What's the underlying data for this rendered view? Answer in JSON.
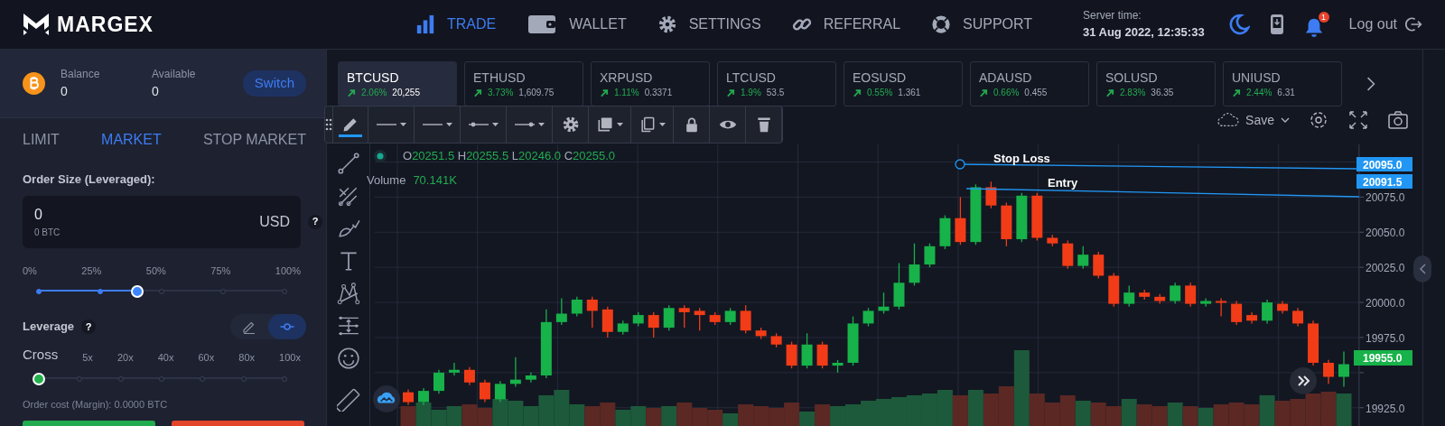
{
  "brand": {
    "name": "MARGEX"
  },
  "nav": [
    {
      "kind": "bars",
      "label": "TRADE",
      "selected": true
    },
    {
      "kind": "wallet",
      "label": "WALLET",
      "selected": false
    },
    {
      "kind": "gear",
      "label": "SETTINGS",
      "selected": false
    },
    {
      "kind": "link",
      "label": "REFERRAL",
      "selected": false
    },
    {
      "kind": "lifebuoy",
      "label": "SUPPORT",
      "selected": false
    }
  ],
  "server_time": {
    "label": "Server time:",
    "value": "31 Aug 2022, 12:35:33"
  },
  "notifications": {
    "count": "1"
  },
  "logout": "Log out",
  "balance": {
    "balance_label": "Balance",
    "balance": "0",
    "available_label": "Available",
    "available": "0",
    "switch": "Switch"
  },
  "order_tabs": [
    {
      "label": "LIMIT",
      "selected": false
    },
    {
      "label": "MARKET",
      "selected": true
    },
    {
      "label": "STOP MARKET",
      "selected": false
    }
  ],
  "order_size": {
    "label": "Order Size (Leveraged):",
    "value": "0",
    "sub": "0 BTC",
    "currency": "USD",
    "help": "?"
  },
  "size_slider": {
    "marks": [
      "0%",
      "25%",
      "50%",
      "75%",
      "100%"
    ],
    "level": 0.4
  },
  "leverage": {
    "label": "Leverage",
    "help": "?",
    "modes": [
      {
        "kind": "pencil",
        "selected": false
      },
      {
        "kind": "slider",
        "selected": true
      }
    ],
    "first_mark": "Cross",
    "marks": [
      "5x",
      "20x",
      "40x",
      "60x",
      "80x",
      "100x"
    ],
    "level": 0
  },
  "order_cost": "Order cost (Margin): 0.0000 BTC",
  "tickers": [
    {
      "symbol": "BTCUSD",
      "change": "2.06%",
      "price": "20,255",
      "selected": true
    },
    {
      "symbol": "ETHUSD",
      "change": "3.73%",
      "price": "1,609.75",
      "selected": false
    },
    {
      "symbol": "XRPUSD",
      "change": "1.11%",
      "price": "0.3371",
      "selected": false
    },
    {
      "symbol": "LTCUSD",
      "change": "1.9%",
      "price": "53.5",
      "selected": false
    },
    {
      "symbol": "EOSUSD",
      "change": "0.55%",
      "price": "1.361",
      "selected": false
    },
    {
      "symbol": "ADAUSD",
      "change": "0.66%",
      "price": "0.455",
      "selected": false
    },
    {
      "symbol": "SOLUSD",
      "change": "2.83%",
      "price": "36.35",
      "selected": false
    },
    {
      "symbol": "UNIUSD",
      "change": "2.44%",
      "price": "6.31",
      "selected": false
    }
  ],
  "drawing_tools": [
    {
      "kind": "pencil",
      "selected": true
    },
    {
      "kind": "line",
      "selected": false
    },
    {
      "kind": "line",
      "selected": false
    },
    {
      "kind": "line-dot-start",
      "selected": false
    },
    {
      "kind": "line-dot-end",
      "selected": false
    },
    {
      "kind": "gear",
      "selected": false
    },
    {
      "kind": "layers",
      "selected": false
    },
    {
      "kind": "copy",
      "selected": false
    },
    {
      "kind": "lock",
      "selected": false
    },
    {
      "kind": "eye",
      "selected": false
    },
    {
      "kind": "trash",
      "selected": false
    }
  ],
  "chart_toolbar": {
    "save": "Save"
  },
  "legend": {
    "items": [
      {
        "key": "O",
        "value": "20251.5"
      },
      {
        "key": "H",
        "value": "20255.5"
      },
      {
        "key": "L",
        "value": "20246.0"
      },
      {
        "key": "C",
        "value": "20255.0"
      }
    ],
    "volume_label": "Volume",
    "volume": "70.141K"
  },
  "chart": {
    "chart_data": {
      "type": "candlestick",
      "grid": true,
      "ohlc": [
        [
          19936,
          19938,
          19927,
          19929
        ],
        [
          19929,
          19939,
          19927,
          19937
        ],
        [
          19937,
          19952,
          19935,
          19950
        ],
        [
          19950,
          19957,
          19948,
          19952
        ],
        [
          19952,
          19954,
          19941,
          19943
        ],
        [
          19943,
          19945,
          19929,
          19931
        ],
        [
          19931,
          19944,
          19929,
          19942
        ],
        [
          19942,
          19961,
          19940,
          19945
        ],
        [
          19945,
          19950,
          19943,
          19948
        ],
        [
          19948,
          19995,
          19946,
          19986
        ],
        [
          19986,
          20003,
          19984,
          19992
        ],
        [
          19992,
          20004,
          19990,
          20002
        ],
        [
          20002,
          20004,
          19982,
          19994
        ],
        [
          19995,
          19997,
          19975,
          19979
        ],
        [
          19979,
          19987,
          19977,
          19985
        ],
        [
          19985,
          19993,
          19983,
          19991
        ],
        [
          19991,
          19993,
          19975,
          19982
        ],
        [
          19982,
          19998,
          19980,
          19996
        ],
        [
          19996,
          19998,
          19982,
          19993
        ],
        [
          19994,
          19996,
          19980,
          19991
        ],
        [
          19991,
          19993,
          19984,
          19986
        ],
        [
          19986,
          19996,
          19984,
          19994
        ],
        [
          19994,
          19998,
          19978,
          19980
        ],
        [
          19980,
          19982,
          19974,
          19976
        ],
        [
          19976,
          19978,
          19968,
          19970
        ],
        [
          19970,
          19972,
          19953,
          19955
        ],
        [
          19955,
          19978,
          19953,
          19970
        ],
        [
          19970,
          19972,
          19953,
          19955
        ],
        [
          19955,
          19959,
          19950,
          19957
        ],
        [
          19957,
          19990,
          19955,
          19985
        ],
        [
          19985,
          19996,
          19983,
          19994
        ],
        [
          19994,
          20007,
          19992,
          19997
        ],
        [
          19997,
          20028,
          19995,
          20014
        ],
        [
          20014,
          20042,
          20012,
          20027
        ],
        [
          20027,
          20042,
          20025,
          20040
        ],
        [
          20040,
          20062,
          20038,
          20060
        ],
        [
          20060,
          20075,
          20041,
          20043
        ],
        [
          20043,
          20084,
          20041,
          20082
        ],
        [
          20082,
          20086,
          20067,
          20069
        ],
        [
          20069,
          20071,
          20040,
          20045
        ],
        [
          20045,
          20078,
          20043,
          20076
        ],
        [
          20076,
          20078,
          20044,
          20046
        ],
        [
          20046,
          20048,
          20040,
          20042
        ],
        [
          20042,
          20044,
          20024,
          20026
        ],
        [
          20026,
          20040,
          20024,
          20034
        ],
        [
          20034,
          20036,
          20017,
          20019
        ],
        [
          20019,
          20021,
          19997,
          19999
        ],
        [
          19999,
          20012,
          19997,
          20007
        ],
        [
          20007,
          20009,
          20002,
          20004
        ],
        [
          20004,
          20006,
          19999,
          20001
        ],
        [
          20001,
          20014,
          19999,
          20012
        ],
        [
          20012,
          20014,
          19997,
          19999
        ],
        [
          19999,
          20003,
          19997,
          20001
        ],
        [
          20001,
          20003,
          19990,
          20000
        ],
        [
          19999,
          20001,
          19984,
          19986
        ],
        [
          19991,
          19993,
          19985,
          19987
        ],
        [
          19987,
          20002,
          19985,
          20000
        ],
        [
          19999,
          20001,
          19992,
          19994
        ],
        [
          19994,
          19996,
          19983,
          19985
        ],
        [
          19985,
          19987,
          19955,
          19957
        ],
        [
          19957,
          19959,
          19942,
          19947
        ],
        [
          19947,
          19965,
          19940,
          19956
        ]
      ],
      "ylim": [
        19912,
        20112.5
      ],
      "yticks": [
        {
          "value": 20075,
          "label": "20075.0"
        },
        {
          "value": 20050,
          "label": "20050.0"
        },
        {
          "value": 20025,
          "label": "20025.0"
        },
        {
          "value": 20000,
          "label": "20000.0"
        },
        {
          "value": 19975,
          "label": "19975.0"
        },
        {
          "value": 19925,
          "label": "19925.0"
        }
      ]
    }
  },
  "orders": [
    {
      "label": "Stop Loss",
      "price": "20095.0"
    },
    {
      "label": "Entry",
      "price": "20091.5"
    }
  ],
  "last_price": "19955.0"
}
